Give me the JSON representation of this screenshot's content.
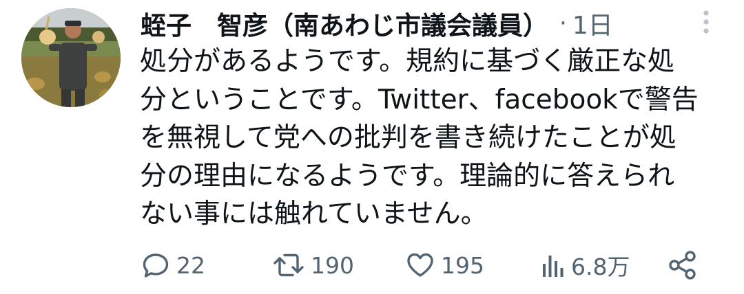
{
  "tweet": {
    "display_name": "蛭子　智彦（南あわじ市議会議員）",
    "separator": "·",
    "timestamp": "1日",
    "text": "処分があるようです。規約に基づく厳正な処\n分ということです。Twitter、facebookで警告\nを無視して党への批判を書き続けたことが処\n分の理由になるようです。理論的に答えられ\nない事には触れていません。"
  },
  "actions": {
    "reply_count": "22",
    "retweet_count": "190",
    "like_count": "195",
    "view_count": "6.8万"
  },
  "icons": {
    "more": "more-vertical-icon",
    "reply": "reply-bubble-icon",
    "retweet": "retweet-icon",
    "like": "heart-icon",
    "views": "views-bar-chart-icon",
    "share": "share-icon"
  },
  "colors": {
    "text_primary": "#0f1419",
    "text_secondary": "#536471",
    "more_icon": "#b9c2cc"
  }
}
